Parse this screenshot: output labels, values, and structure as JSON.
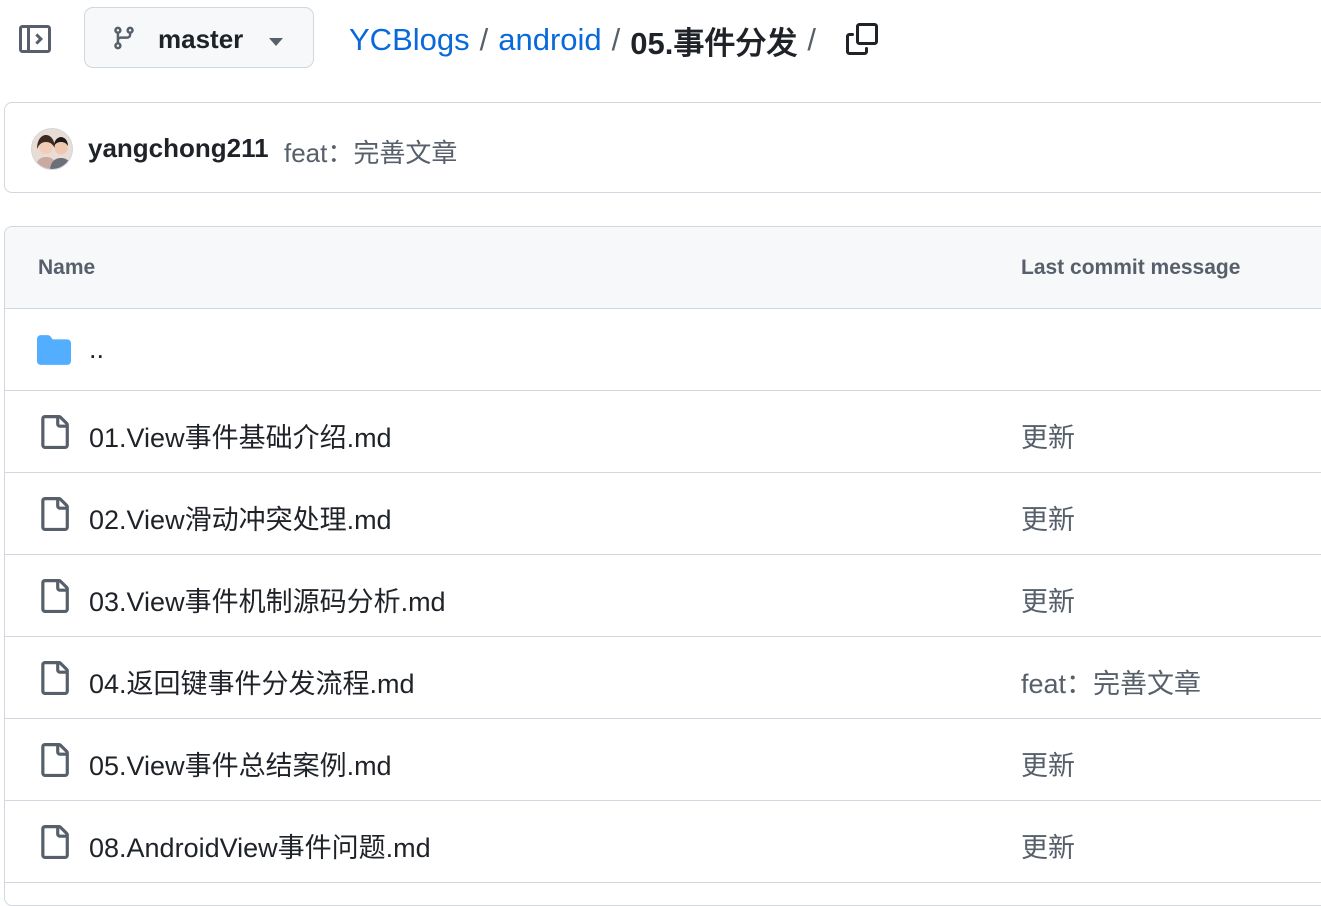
{
  "header": {
    "branch": "master",
    "breadcrumb": {
      "repo": "YCBlogs",
      "sep1": "/",
      "folder": "android",
      "sep2": "/",
      "current": "05.事件分发",
      "sep3": "/"
    }
  },
  "commit": {
    "author": "yangchong211",
    "message": "feat：完善文章"
  },
  "table": {
    "columns": {
      "name": "Name",
      "message": "Last commit message"
    },
    "parent": "..",
    "rows": [
      {
        "name": "01.View事件基础介绍.md",
        "message": "更新"
      },
      {
        "name": "02.View滑动冲突处理.md",
        "message": "更新"
      },
      {
        "name": "03.View事件机制源码分析.md",
        "message": "更新"
      },
      {
        "name": "04.返回键事件分发流程.md",
        "message": "feat：完善文章"
      },
      {
        "name": "05.View事件总结案例.md",
        "message": "更新"
      },
      {
        "name": "08.AndroidView事件问题.md",
        "message": "更新"
      }
    ]
  },
  "icons": {
    "panel": "sidebar-expand-icon",
    "branch": "git-branch-icon",
    "caret": "triangle-down-icon",
    "copy": "copy-icon",
    "folder": "folder-icon",
    "file": "file-icon"
  },
  "colors": {
    "link": "#0969da",
    "folder": "#54aeff",
    "muted": "#57606a",
    "border": "#d0d7de"
  }
}
